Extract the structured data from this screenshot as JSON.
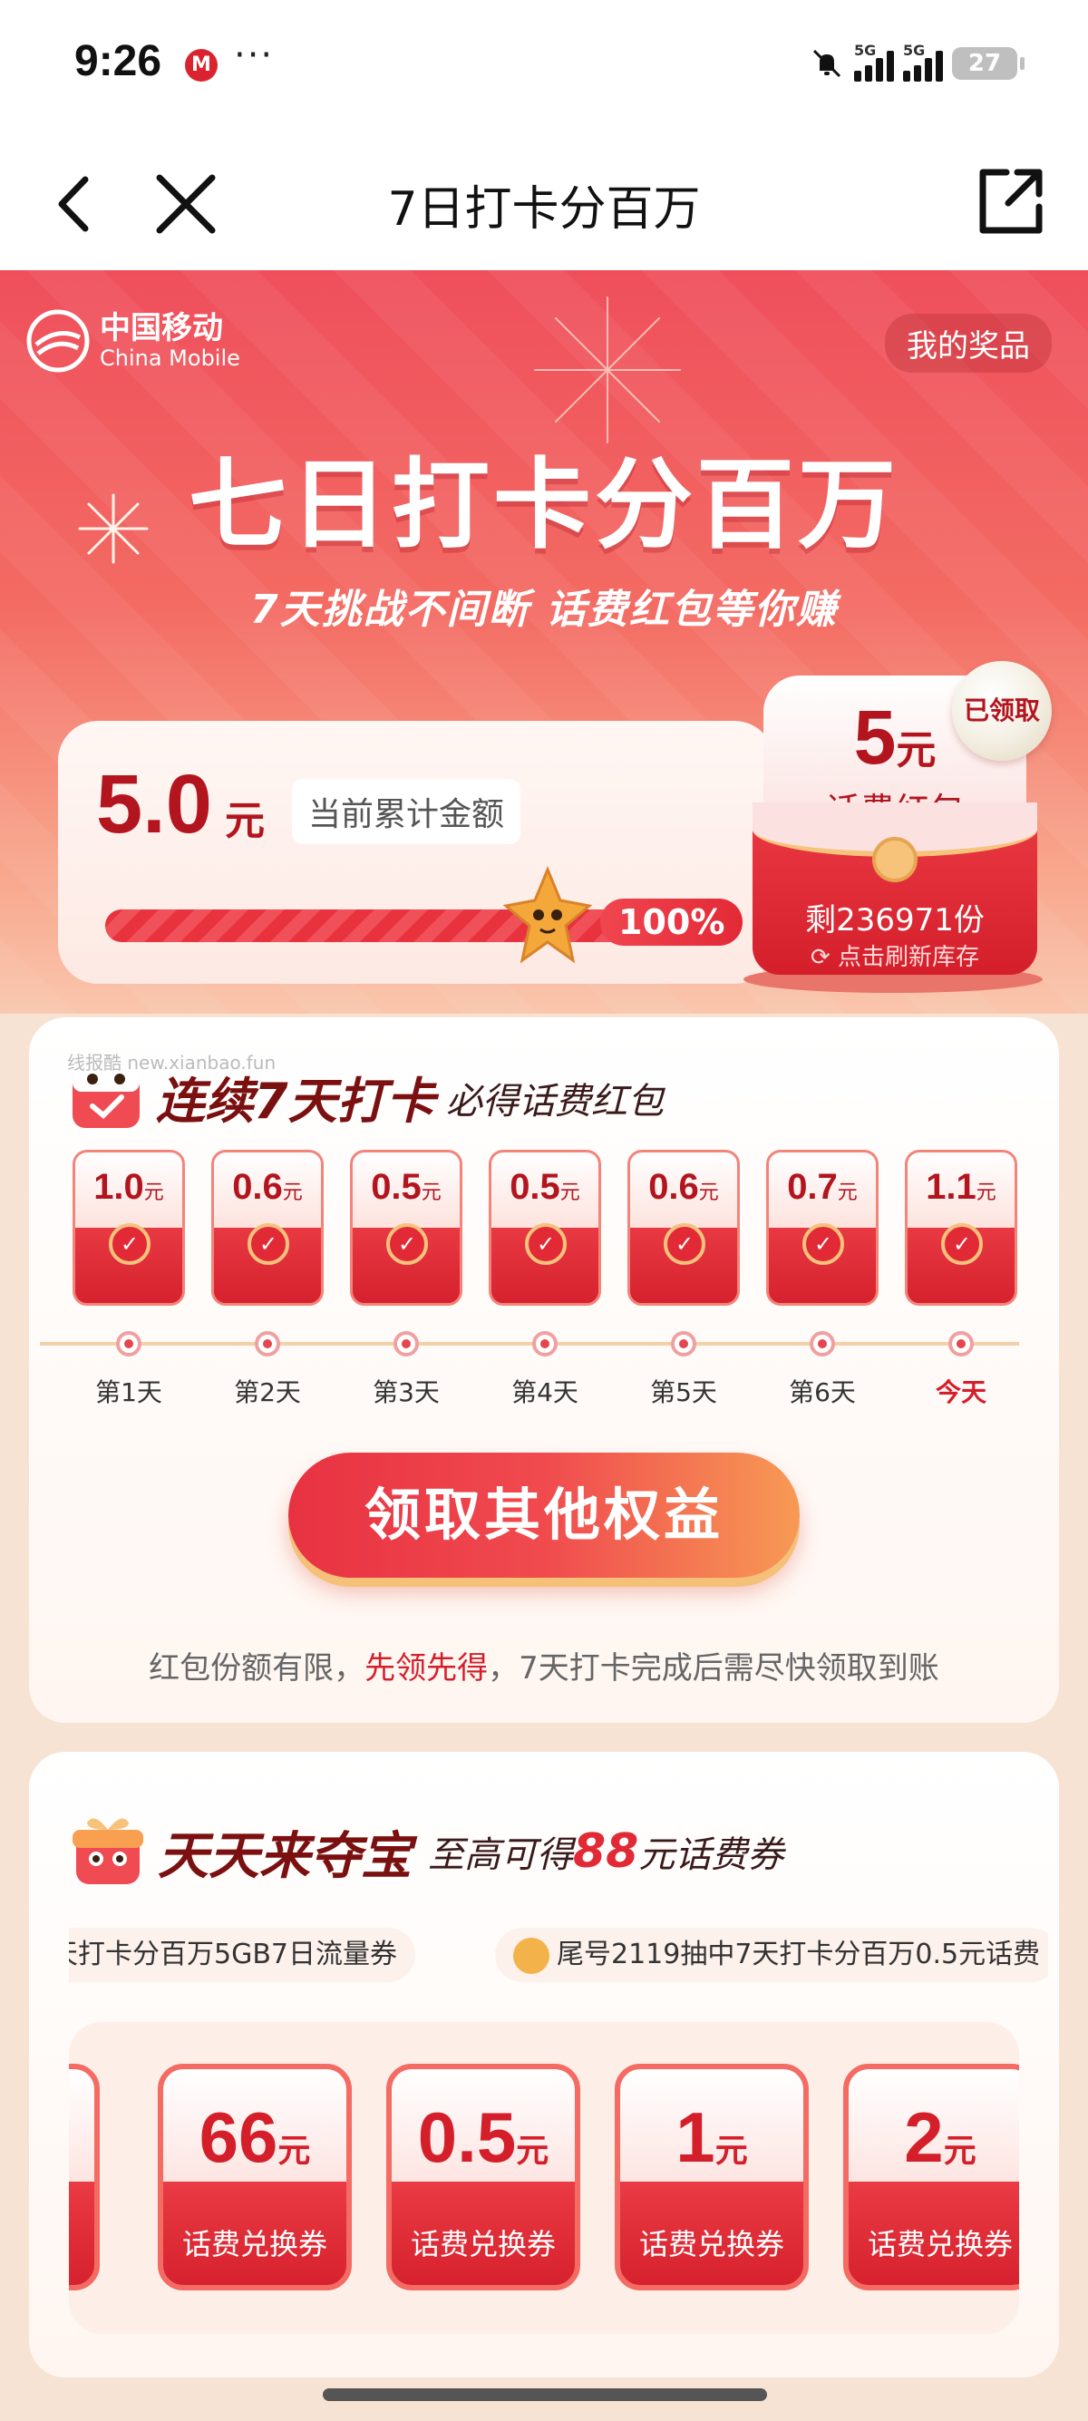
{
  "status_bar": {
    "time": "9:26",
    "app_icon": "M",
    "more": "···",
    "network_1": "5G",
    "network_2": "5G",
    "battery": "27"
  },
  "nav": {
    "title": "7日打卡分百万",
    "back_icon": "chevron-left-icon",
    "close_icon": "close-icon",
    "share_icon": "share-icon"
  },
  "hero": {
    "brand_cn": "中国移动",
    "brand_en": "China Mobile",
    "my_prizes": "我的奖品",
    "title": "七日打卡分百万",
    "subtitle": "7天挑战不间断 话费红包等你赚"
  },
  "summary": {
    "amount": "5.0",
    "unit": "元",
    "label": "当前累计金额",
    "progress_percent": 100,
    "progress_text": "100%"
  },
  "red_packet": {
    "amount": "5",
    "unit": "元",
    "label": "话费红包",
    "remaining": "剩236971份",
    "refresh": "点击刷新库存",
    "badge": "已领取"
  },
  "checkin": {
    "watermark": "线报酷 new.xianbao.fun",
    "title": "连续7天打卡",
    "subtitle": "必得话费红包",
    "days": [
      {
        "amount": "1.0",
        "unit": "元",
        "label": "第1天",
        "today": false
      },
      {
        "amount": "0.6",
        "unit": "元",
        "label": "第2天",
        "today": false
      },
      {
        "amount": "0.5",
        "unit": "元",
        "label": "第3天",
        "today": false
      },
      {
        "amount": "0.5",
        "unit": "元",
        "label": "第4天",
        "today": false
      },
      {
        "amount": "0.6",
        "unit": "元",
        "label": "第5天",
        "today": false
      },
      {
        "amount": "0.7",
        "unit": "元",
        "label": "第6天",
        "today": false
      },
      {
        "amount": "1.1",
        "unit": "元",
        "label": "今天",
        "today": true
      }
    ],
    "button": "领取其他权益",
    "notice_prefix": "红包份额有限，",
    "notice_highlight": "先领先得",
    "notice_suffix": "，7天打卡完成后需尽快领取到账"
  },
  "treasure": {
    "title": "天天来夺宝",
    "subtitle_prefix": "至高可得",
    "subtitle_number": "88",
    "subtitle_suffix": "元话费券",
    "marquee": [
      "天打卡分百万5GB7日流量券",
      "尾号2119抽中7天打卡分百万0.5元话费"
    ],
    "coupons": [
      {
        "amount": "66",
        "unit": "元",
        "label": "话费兑换券"
      },
      {
        "amount": "0.5",
        "unit": "元",
        "label": "话费兑换券"
      },
      {
        "amount": "1",
        "unit": "元",
        "label": "话费兑换券"
      },
      {
        "amount": "2",
        "unit": "元",
        "label": "话费兑换券"
      }
    ]
  },
  "colors": {
    "brand_red": "#d41f2b",
    "dark_red": "#7a1010",
    "gold": "#f4c27d"
  }
}
